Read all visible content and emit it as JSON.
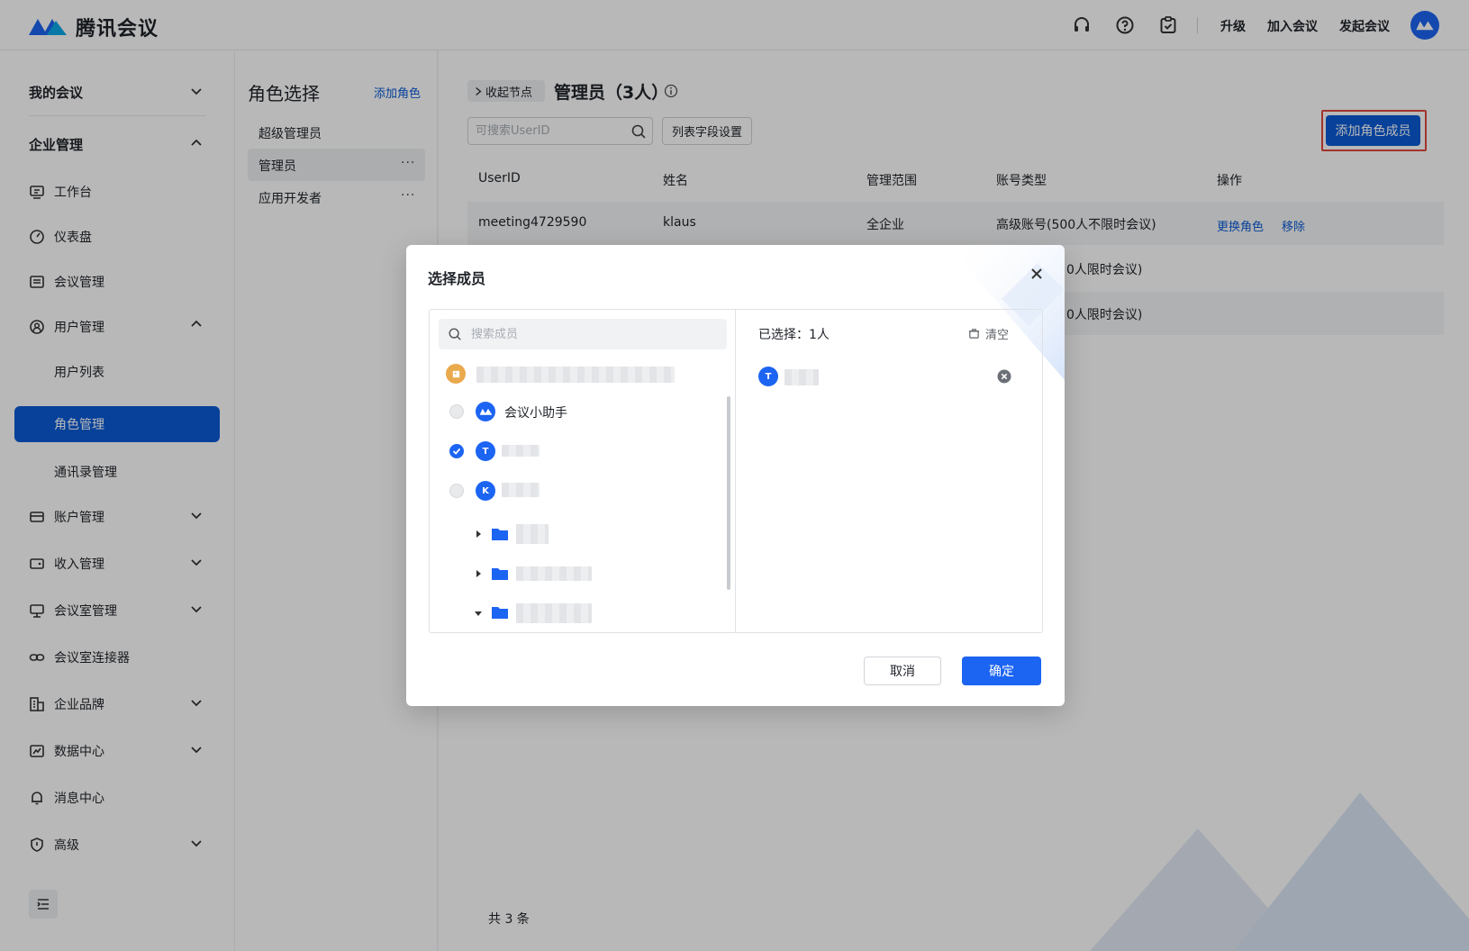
{
  "app": {
    "title": "腾讯会议"
  },
  "header": {
    "icons": [
      "headset-icon",
      "help-icon",
      "task-icon"
    ],
    "links": {
      "upgrade": "升级",
      "join": "加入会议",
      "start": "发起会议"
    }
  },
  "nav": {
    "my_meetings": "我的会议",
    "enterprise": "企业管理",
    "items": {
      "workbench": "工作台",
      "dashboard": "仪表盘",
      "meetings": "会议管理",
      "users": "用户管理",
      "user_list": "用户列表",
      "roles": "角色管理",
      "contacts": "通讯录管理",
      "accounts": "账户管理",
      "revenue": "收入管理",
      "rooms": "会议室管理",
      "connector": "会议室连接器",
      "brand": "企业品牌",
      "data": "数据中心",
      "messages": "消息中心",
      "advanced": "高级"
    }
  },
  "roles": {
    "title": "角色选择",
    "add": "添加角色",
    "list": [
      "超级管理员",
      "管理员",
      "应用开发者"
    ],
    "more": "···"
  },
  "main": {
    "collapse": "收起节点",
    "title": "管理员（3人）",
    "search_placeholder": "可搜索UserID",
    "field_settings": "列表字段设置",
    "add_member": "添加角色成员",
    "columns": [
      "UserID",
      "姓名",
      "管理范围",
      "账号类型",
      "操作"
    ],
    "rows": [
      {
        "userid": "meeting4729590",
        "name": "klaus",
        "scope": "全企业",
        "type": "高级账号(500人不限时会议)",
        "op1": "更换角色",
        "op2": "移除"
      },
      {
        "type_tail": "0人限时会议)"
      },
      {
        "type_tail": "0人限时会议)"
      }
    ],
    "total": "共 3 条"
  },
  "modal": {
    "title": "选择成员",
    "search_placeholder": "搜索成员",
    "assistant": "会议小助手",
    "avatar_t": "T",
    "avatar_k": "K",
    "selected": "已选择：1人",
    "clear": "清空",
    "cancel": "取消",
    "ok": "确定"
  },
  "colors": {
    "accent": "#1c64f2",
    "nav_active": "#0a5bd6",
    "highlight_border": "#e0483d"
  }
}
